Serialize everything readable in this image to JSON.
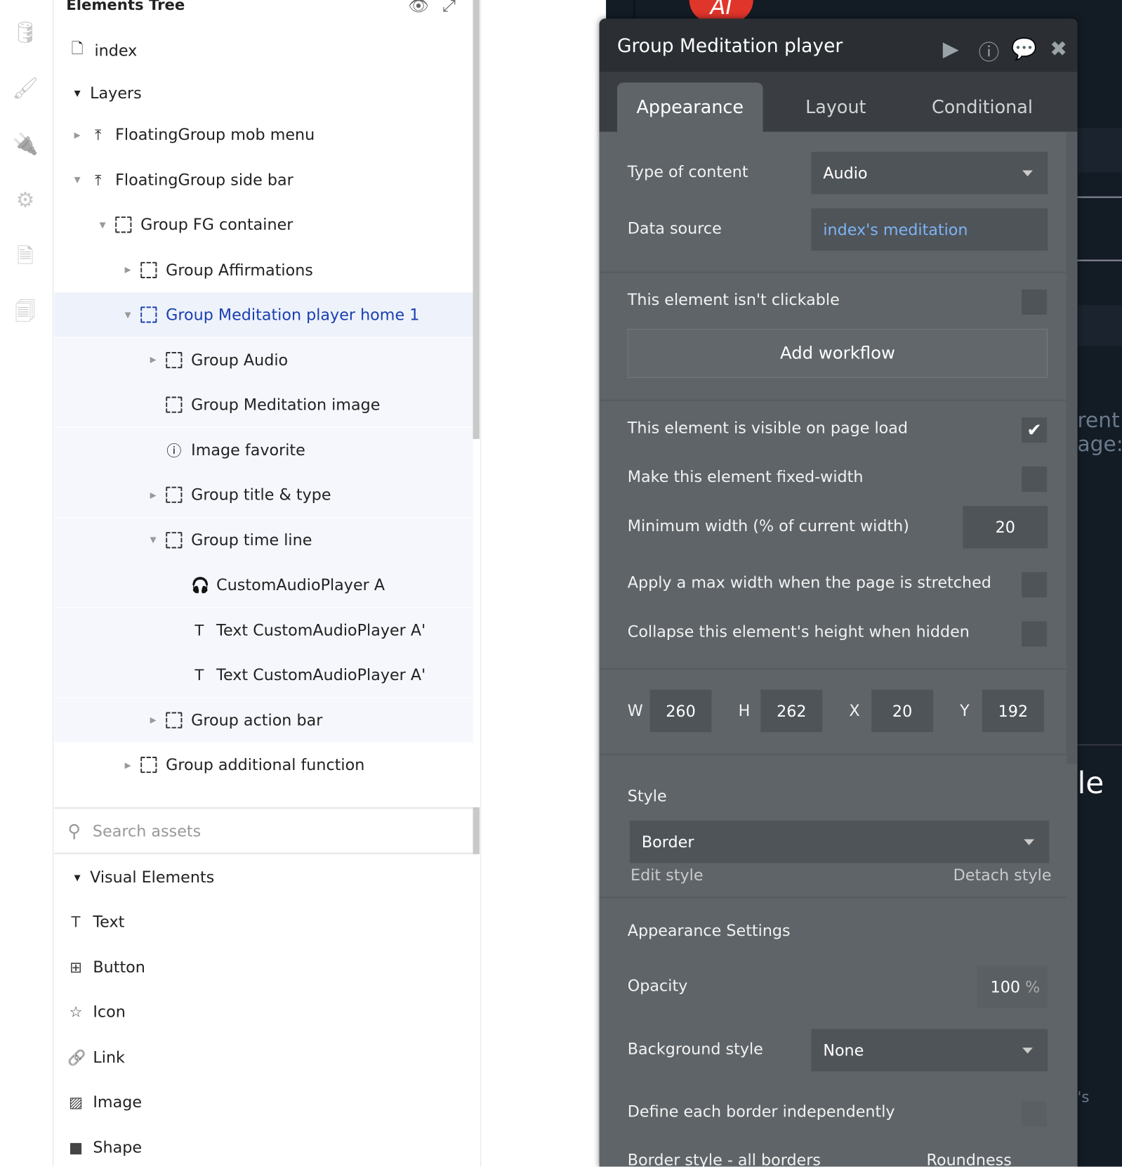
{
  "sidebar_icons": [
    "database-icon",
    "brush-icon",
    "plug-icon",
    "gear-icon",
    "document-icon",
    "copy-document-icon"
  ],
  "tree": {
    "title": "Elements Tree",
    "page": "index",
    "layers_label": "Layers",
    "rows": [
      {
        "label": "FloatingGroup mob menu",
        "icon": "float-icon",
        "caret": "right",
        "indent": 1
      },
      {
        "label": "FloatingGroup side bar",
        "icon": "float-icon",
        "caret": "down",
        "indent": 1
      },
      {
        "label": "Group FG container",
        "icon": "group-icon",
        "caret": "down",
        "indent": 2
      },
      {
        "label": "Group Affirmations",
        "icon": "group-icon",
        "caret": "right",
        "indent": 3
      },
      {
        "label": "Group Meditation player home 1",
        "icon": "group-icon",
        "caret": "down",
        "indent": 3,
        "selected": true
      },
      {
        "label": "Group Audio",
        "icon": "group-icon",
        "caret": "right",
        "indent": 4
      },
      {
        "label": "Group Meditation image",
        "icon": "group-icon",
        "caret": "",
        "indent": 4
      },
      {
        "label": "Image favorite",
        "icon": "info-icon",
        "caret": "",
        "indent": 4
      },
      {
        "label": "Group title & type",
        "icon": "group-icon",
        "caret": "right",
        "indent": 4
      },
      {
        "label": "Group time line",
        "icon": "group-icon",
        "caret": "down",
        "indent": 4
      },
      {
        "label": "CustomAudioPlayer A",
        "icon": "headphones-icon",
        "caret": "",
        "indent": 5
      },
      {
        "label": "Text CustomAudioPlayer A'",
        "icon": "text-icon",
        "caret": "",
        "indent": 5
      },
      {
        "label": "Text CustomAudioPlayer A'",
        "icon": "text-icon",
        "caret": "",
        "indent": 5
      },
      {
        "label": "Group action bar",
        "icon": "group-icon",
        "caret": "right",
        "indent": 4
      },
      {
        "label": "Group additional function",
        "icon": "group-icon",
        "caret": "right",
        "indent": 3
      }
    ]
  },
  "assets": {
    "search_placeholder": "Search assets",
    "section": "Visual Elements",
    "items": [
      {
        "label": "Text",
        "icon": "text-icon",
        "glyph": "T"
      },
      {
        "label": "Button",
        "icon": "button-icon",
        "glyph": "⊞"
      },
      {
        "label": "Icon",
        "icon": "star-icon",
        "glyph": "☆"
      },
      {
        "label": "Link",
        "icon": "link-icon",
        "glyph": "🔗"
      },
      {
        "label": "Image",
        "icon": "image-icon",
        "glyph": "▨"
      },
      {
        "label": "Shape",
        "icon": "shape-icon",
        "glyph": "■"
      }
    ]
  },
  "panel": {
    "title": "Group Meditation player",
    "tabs": [
      "Appearance",
      "Layout",
      "Conditional"
    ],
    "type_of_content_label": "Type of content",
    "type_of_content": "Audio",
    "data_source_label": "Data source",
    "data_source": "index's meditation",
    "not_clickable": "This element isn't clickable",
    "add_workflow": "Add workflow",
    "visible_on_load": "This element is visible on page load",
    "visible_checked": true,
    "fixed_width": "Make this element fixed-width",
    "min_width_label": "Minimum width (% of current width)",
    "min_width": "20",
    "max_width": "Apply a max width when the page is stretched",
    "collapse": "Collapse this element's height when hidden",
    "dims": {
      "W": "260",
      "H": "262",
      "X": "20",
      "Y": "192"
    },
    "style_label": "Style",
    "style": "Border",
    "edit_style": "Edit style",
    "detach_style": "Detach style",
    "appearance_settings": "Appearance Settings",
    "opacity_label": "Opacity",
    "opacity": "100",
    "opacity_unit": "%",
    "bg_style_label": "Background style",
    "bg_style": "None",
    "borders_independent": "Define each border independently",
    "border_style": "Border style - all borders",
    "roundness": "Roundness",
    "data_source_color": "#7db4f5"
  },
  "canvas": {
    "badge": "AI",
    "texts": [
      "rent",
      "age:p",
      "le",
      "'s"
    ]
  }
}
